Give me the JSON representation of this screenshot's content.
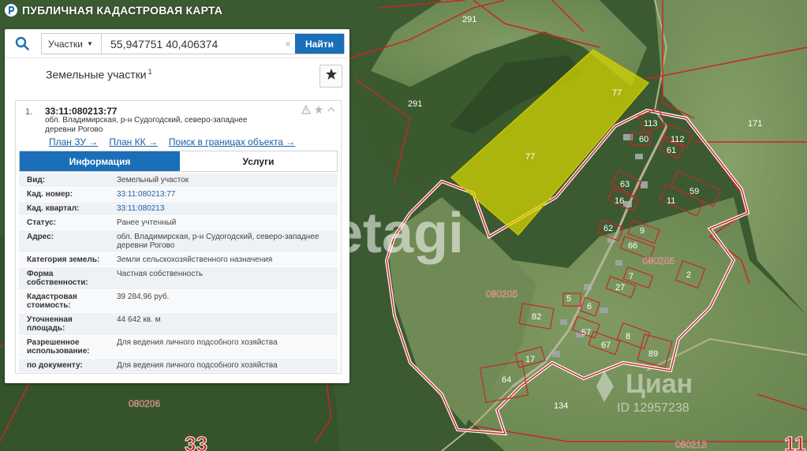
{
  "header": {
    "title": "ПУБЛИЧНАЯ КАДАСТРОВАЯ КАРТА"
  },
  "search": {
    "type_label": "Участки",
    "query": "55,947751 40,406374",
    "clear_label": "×",
    "find_label": "Найти"
  },
  "section": {
    "title": "Земельные участки",
    "count": "1"
  },
  "result": {
    "index": "1.",
    "cad_number": "33:11:080213:77",
    "address": "обл. Владимирская, р-н Судогодский, северо-западнее деревни Рогово",
    "links": [
      "План ЗУ →",
      "План КК →",
      "Поиск в границах объекта →"
    ],
    "tabs": [
      "Информация",
      "Услуги"
    ]
  },
  "info": [
    {
      "key": "Вид:",
      "value": "Земельный участок"
    },
    {
      "key": "Кад. номер:",
      "value": "33:11:080213:77"
    },
    {
      "key": "Кад. квартал:",
      "value": "33:11:080213"
    },
    {
      "key": "Статус:",
      "value": "Ранее учтенный"
    },
    {
      "key": "Адрес:",
      "value": "обл. Владимирская, р-н Судогодский, северо-западнее деревни Рогово"
    },
    {
      "key": "Категория земель:",
      "value": "Земли сельскохозяйственного назначения"
    },
    {
      "key": "Форма собственности:",
      "value": "Частная собственность"
    },
    {
      "key": "Кадастровая стоимость:",
      "value": "39 284,96 руб."
    },
    {
      "key": "Уточненная площадь:",
      "value": "44 642 кв. м"
    },
    {
      "key": "Разрешенное использование:",
      "value": "Для ведения личного подсобного хозяйства"
    },
    {
      "key": "по документу:",
      "value": "Для ведения личного подсобного хозяйства"
    }
  ],
  "map": {
    "labels": {
      "l291a": "291",
      "l291b": "291",
      "l171": "171",
      "l77a": "77",
      "l77b": "77",
      "l113": "113",
      "l112": "112",
      "l60": "60",
      "l61": "61",
      "l63": "63",
      "l59": "59",
      "l16": "16",
      "l11": "11",
      "l62": "62",
      "l9": "9",
      "l66": "66",
      "q080205a": "080205",
      "l2": "2",
      "l7": "7",
      "l27": "27",
      "q080205b": "080205",
      "l5": "5",
      "l6": "6",
      "l82": "82",
      "l57": "57",
      "l8": "8",
      "l89": "89",
      "l67": "67",
      "l17": "17",
      "l64": "64",
      "l134": "134",
      "q080206": "080206",
      "q080213": "080213",
      "big33": "33",
      "big11": "11"
    },
    "watermark_etagi": "etagi",
    "watermark_cian": "Циан",
    "watermark_id": "ID 12957238"
  },
  "colors": {
    "accent": "#1a6fb8",
    "parcel_fill": "#d8d800",
    "boundary": "#c62828",
    "label": "#ffffff"
  }
}
